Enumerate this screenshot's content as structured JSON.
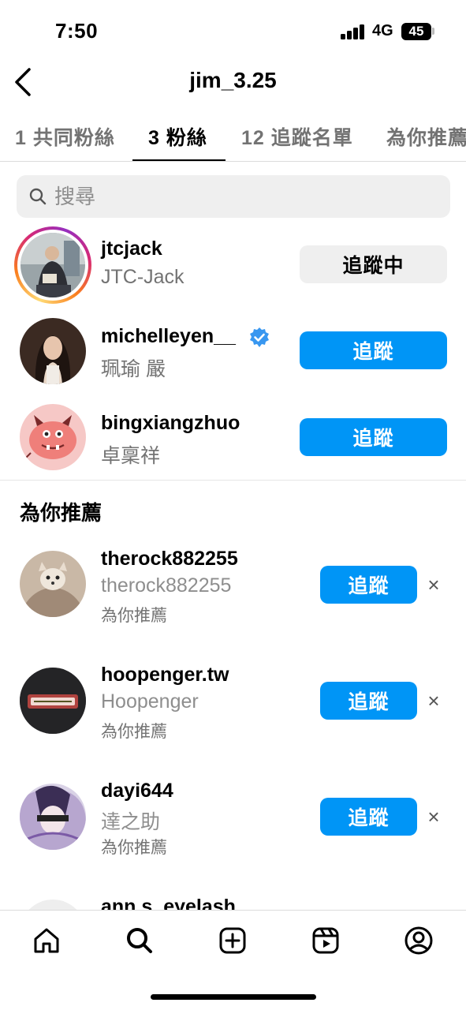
{
  "status_bar": {
    "time": "7:50",
    "network": "4G",
    "battery": "45"
  },
  "header": {
    "title": "jim_3.25"
  },
  "tabs": [
    {
      "label": "1 共同粉絲"
    },
    {
      "label": "3 粉絲"
    },
    {
      "label": "12 追蹤名單"
    },
    {
      "label": "為你推薦"
    }
  ],
  "search": {
    "placeholder": "搜尋"
  },
  "followers": [
    {
      "username": "jtcjack",
      "name": "JTC-Jack",
      "button": "追蹤中",
      "verified": false
    },
    {
      "username": "michelleyen__",
      "name": "珮瑜 嚴",
      "button": "追蹤",
      "verified": true
    },
    {
      "username": "bingxiangzhuo",
      "name": "卓稟祥",
      "button": "追蹤",
      "verified": false
    }
  ],
  "suggested": {
    "title": "為你推薦",
    "items": [
      {
        "username": "therock882255",
        "name": "therock882255",
        "reason": "為你推薦",
        "button": "追蹤",
        "dismiss": "×"
      },
      {
        "username": "hoopenger.tw",
        "name": "Hoopenger",
        "reason": "為你推薦",
        "button": "追蹤",
        "dismiss": "×"
      },
      {
        "username": "dayi644",
        "name": "達之助",
        "reason": "為你推薦",
        "button": "追蹤",
        "dismiss": "×"
      },
      {
        "username": "ann.s_eyelash"
      }
    ]
  },
  "bottom_nav": [
    "home-icon",
    "search-icon",
    "create-icon",
    "reels-icon",
    "profile-icon"
  ],
  "colors": {
    "accent": "#0095f6",
    "muted": "#737373",
    "field_bg": "#efefef"
  }
}
